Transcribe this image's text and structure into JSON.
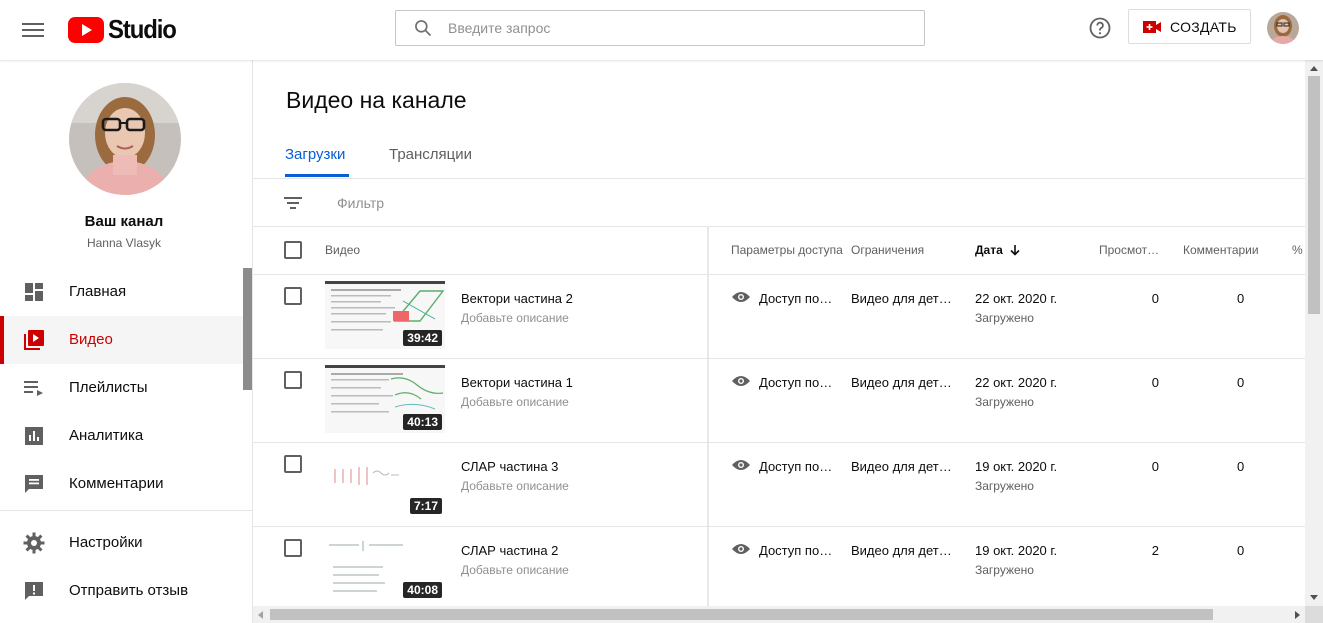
{
  "header": {
    "logo_text": "Studio",
    "search_placeholder": "Введите запрос",
    "create_label": "СОЗДАТЬ"
  },
  "sidebar": {
    "channel_title": "Ваш канал",
    "channel_name": "Hanna Vlasyk",
    "items": [
      {
        "label": "Главная",
        "icon": "dashboard-icon"
      },
      {
        "label": "Видео",
        "icon": "video-library-icon",
        "active": true
      },
      {
        "label": "Плейлисты",
        "icon": "playlist-icon"
      },
      {
        "label": "Аналитика",
        "icon": "analytics-icon"
      },
      {
        "label": "Комментарии",
        "icon": "comments-icon"
      },
      {
        "label": "Настройки",
        "icon": "settings-gear-icon"
      },
      {
        "label": "Отправить отзыв",
        "icon": "feedback-icon"
      }
    ]
  },
  "main": {
    "title": "Видео на канале",
    "tabs": [
      {
        "label": "Загрузки",
        "active": true
      },
      {
        "label": "Трансляции",
        "active": false
      }
    ],
    "filter_label": "Фильтр",
    "columns": {
      "video": "Видео",
      "visibility": "Параметры доступа",
      "restrictions": "Ограничения",
      "date": "Дата",
      "views": "Просмот…",
      "comments": "Комментарии",
      "likes": "% \""
    },
    "rows": [
      {
        "duration": "39:42",
        "title": "Вектори частина 2",
        "description": "Добавьте описание",
        "visibility": "Доступ по…",
        "restrictions": "Видео для дет…",
        "date": "22 окт. 2020 г.",
        "status": "Загружено",
        "views": "0",
        "comments": "0"
      },
      {
        "duration": "40:13",
        "title": "Вектори частина 1",
        "description": "Добавьте описание",
        "visibility": "Доступ по…",
        "restrictions": "Видео для дет…",
        "date": "22 окт. 2020 г.",
        "status": "Загружено",
        "views": "0",
        "comments": "0"
      },
      {
        "duration": "7:17",
        "title": "СЛАР частина 3",
        "description": "Добавьте описание",
        "visibility": "Доступ по…",
        "restrictions": "Видео для дет…",
        "date": "19 окт. 2020 г.",
        "status": "Загружено",
        "views": "0",
        "comments": "0"
      },
      {
        "duration": "40:08",
        "title": "СЛАР частина 2",
        "description": "Добавьте описание",
        "visibility": "Доступ по…",
        "restrictions": "Видео для дет…",
        "date": "19 окт. 2020 г.",
        "status": "Загружено",
        "views": "2",
        "comments": "0"
      }
    ]
  },
  "colors": {
    "accent": "#065fd4",
    "active_nav": "#cc0000",
    "brand": "#ff0000"
  }
}
